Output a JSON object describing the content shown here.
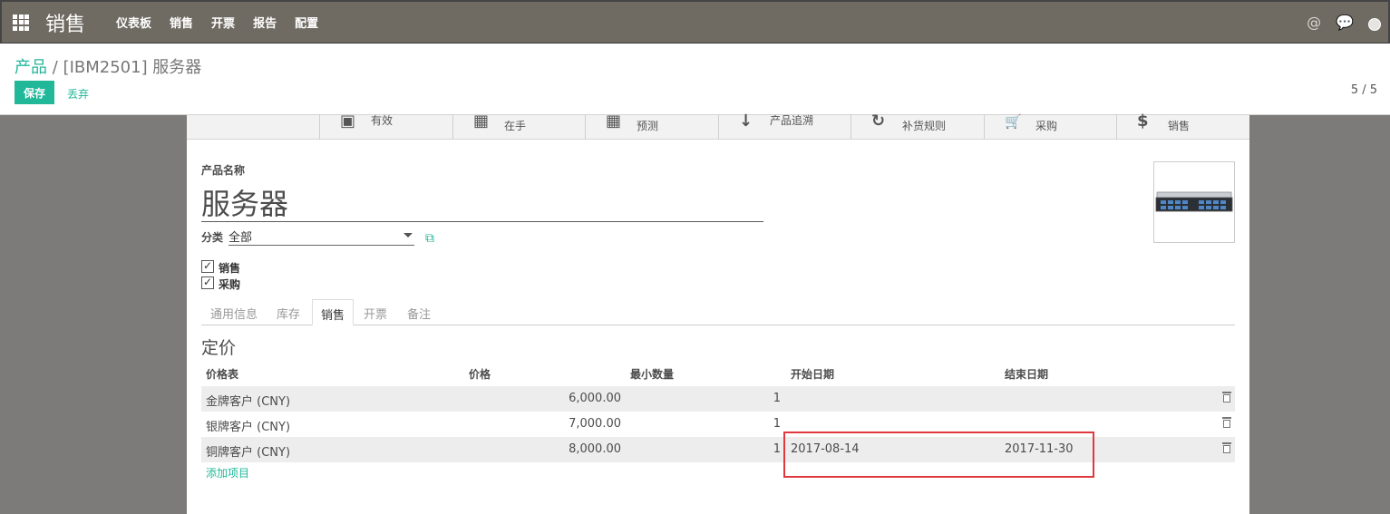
{
  "nav": {
    "brand": "销售",
    "menu": [
      "仪表板",
      "销售",
      "开票",
      "报告",
      "配置"
    ],
    "at_icon": "@",
    "chat_icon": "💬"
  },
  "breadcrumb": {
    "parent": "产品",
    "separator": "/",
    "current": "[IBM2501] 服务器"
  },
  "actions": {
    "save": "保存",
    "discard": "丢弃"
  },
  "pager": "5 / 5",
  "stat_buttons": [
    {
      "icon": "archive-icon",
      "glyph": "▣",
      "label": "有效"
    },
    {
      "icon": "building-icon",
      "glyph": "▦",
      "label": "在手"
    },
    {
      "icon": "building-icon",
      "glyph": "▦",
      "label": "预测"
    },
    {
      "icon": "arrow-down-icon",
      "glyph": "↓",
      "label": "产品追溯"
    },
    {
      "icon": "refresh-icon",
      "glyph": "↻",
      "label": "补货规则"
    },
    {
      "icon": "cart-icon",
      "glyph": "🛒",
      "label": "采购"
    },
    {
      "icon": "dollar-icon",
      "glyph": "$",
      "label": "销售"
    }
  ],
  "form": {
    "name_label": "产品名称",
    "name_value": "服务器",
    "category_label": "分类",
    "category_value": "全部",
    "sale_ok_label": "销售",
    "purchase_ok_label": "采购"
  },
  "tabs": [
    {
      "label": "通用信息",
      "active": false
    },
    {
      "label": "库存",
      "active": false
    },
    {
      "label": "销售",
      "active": true
    },
    {
      "label": "开票",
      "active": false
    },
    {
      "label": "备注",
      "active": false
    }
  ],
  "pricing": {
    "title": "定价",
    "headers": [
      "价格表",
      "价格",
      "最小数量",
      "开始日期",
      "结束日期"
    ],
    "rows": [
      {
        "pricelist": "金牌客户 (CNY)",
        "price": "6,000.00",
        "min_qty": "1",
        "date_start": "",
        "date_end": ""
      },
      {
        "pricelist": "银牌客户 (CNY)",
        "price": "7,000.00",
        "min_qty": "1",
        "date_start": "",
        "date_end": ""
      },
      {
        "pricelist": "铜牌客户 (CNY)",
        "price": "8,000.00",
        "min_qty": "1",
        "date_start": "2017-08-14",
        "date_end": "2017-11-30"
      }
    ],
    "add_line": "添加项目"
  },
  "colors": {
    "primary": "#21b799",
    "navbar": "#6f6a62",
    "highlight": "#e0383e"
  }
}
